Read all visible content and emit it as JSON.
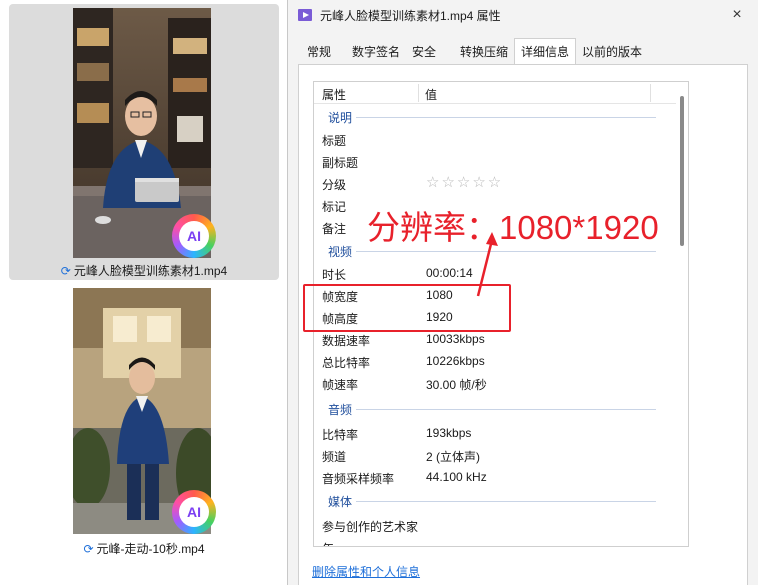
{
  "explorer": {
    "files": [
      {
        "name": "元峰人脸模型训练素材1.mp4",
        "badge": "AI",
        "selected": true
      },
      {
        "name": "元峰-走动-10秒.mp4",
        "badge": "AI",
        "selected": false
      }
    ]
  },
  "dialog": {
    "title": "元峰人脸模型训练素材1.mp4 属性",
    "close_icon": "×",
    "tabs": [
      "常规",
      "数字签名",
      "安全",
      "转换压缩",
      "详细信息",
      "以前的版本"
    ],
    "active_tab": "详细信息",
    "columns": {
      "property": "属性",
      "value": "值"
    },
    "sections": [
      {
        "label": "说明",
        "rows": [
          {
            "key": "标题",
            "value": ""
          },
          {
            "key": "副标题",
            "value": ""
          },
          {
            "key": "分级",
            "value": "☆☆☆☆☆"
          },
          {
            "key": "标记",
            "value": ""
          },
          {
            "key": "备注",
            "value": ""
          }
        ]
      },
      {
        "label": "视频",
        "rows": [
          {
            "key": "时长",
            "value": "00:00:14"
          },
          {
            "key": "帧宽度",
            "value": "1080"
          },
          {
            "key": "帧高度",
            "value": "1920"
          },
          {
            "key": "数据速率",
            "value": "10033kbps"
          },
          {
            "key": "总比特率",
            "value": "10226kbps"
          },
          {
            "key": "帧速率",
            "value": "30.00 帧/秒"
          }
        ]
      },
      {
        "label": "音频",
        "rows": [
          {
            "key": "比特率",
            "value": "193kbps"
          },
          {
            "key": "频道",
            "value": "2 (立体声)"
          },
          {
            "key": "音频采样频率",
            "value": "44.100 kHz"
          }
        ]
      },
      {
        "label": "媒体",
        "rows": [
          {
            "key": "参与创作的艺术家",
            "value": ""
          },
          {
            "key": "年",
            "value": ""
          }
        ]
      }
    ],
    "footer_link": "删除属性和个人信息"
  },
  "annotation": {
    "text": "分辨率：1080*1920",
    "color": "#e8212b"
  },
  "colors": {
    "accent": "#1e6fd9",
    "group_label": "#1f4e9c",
    "annotation": "#e8212b"
  }
}
